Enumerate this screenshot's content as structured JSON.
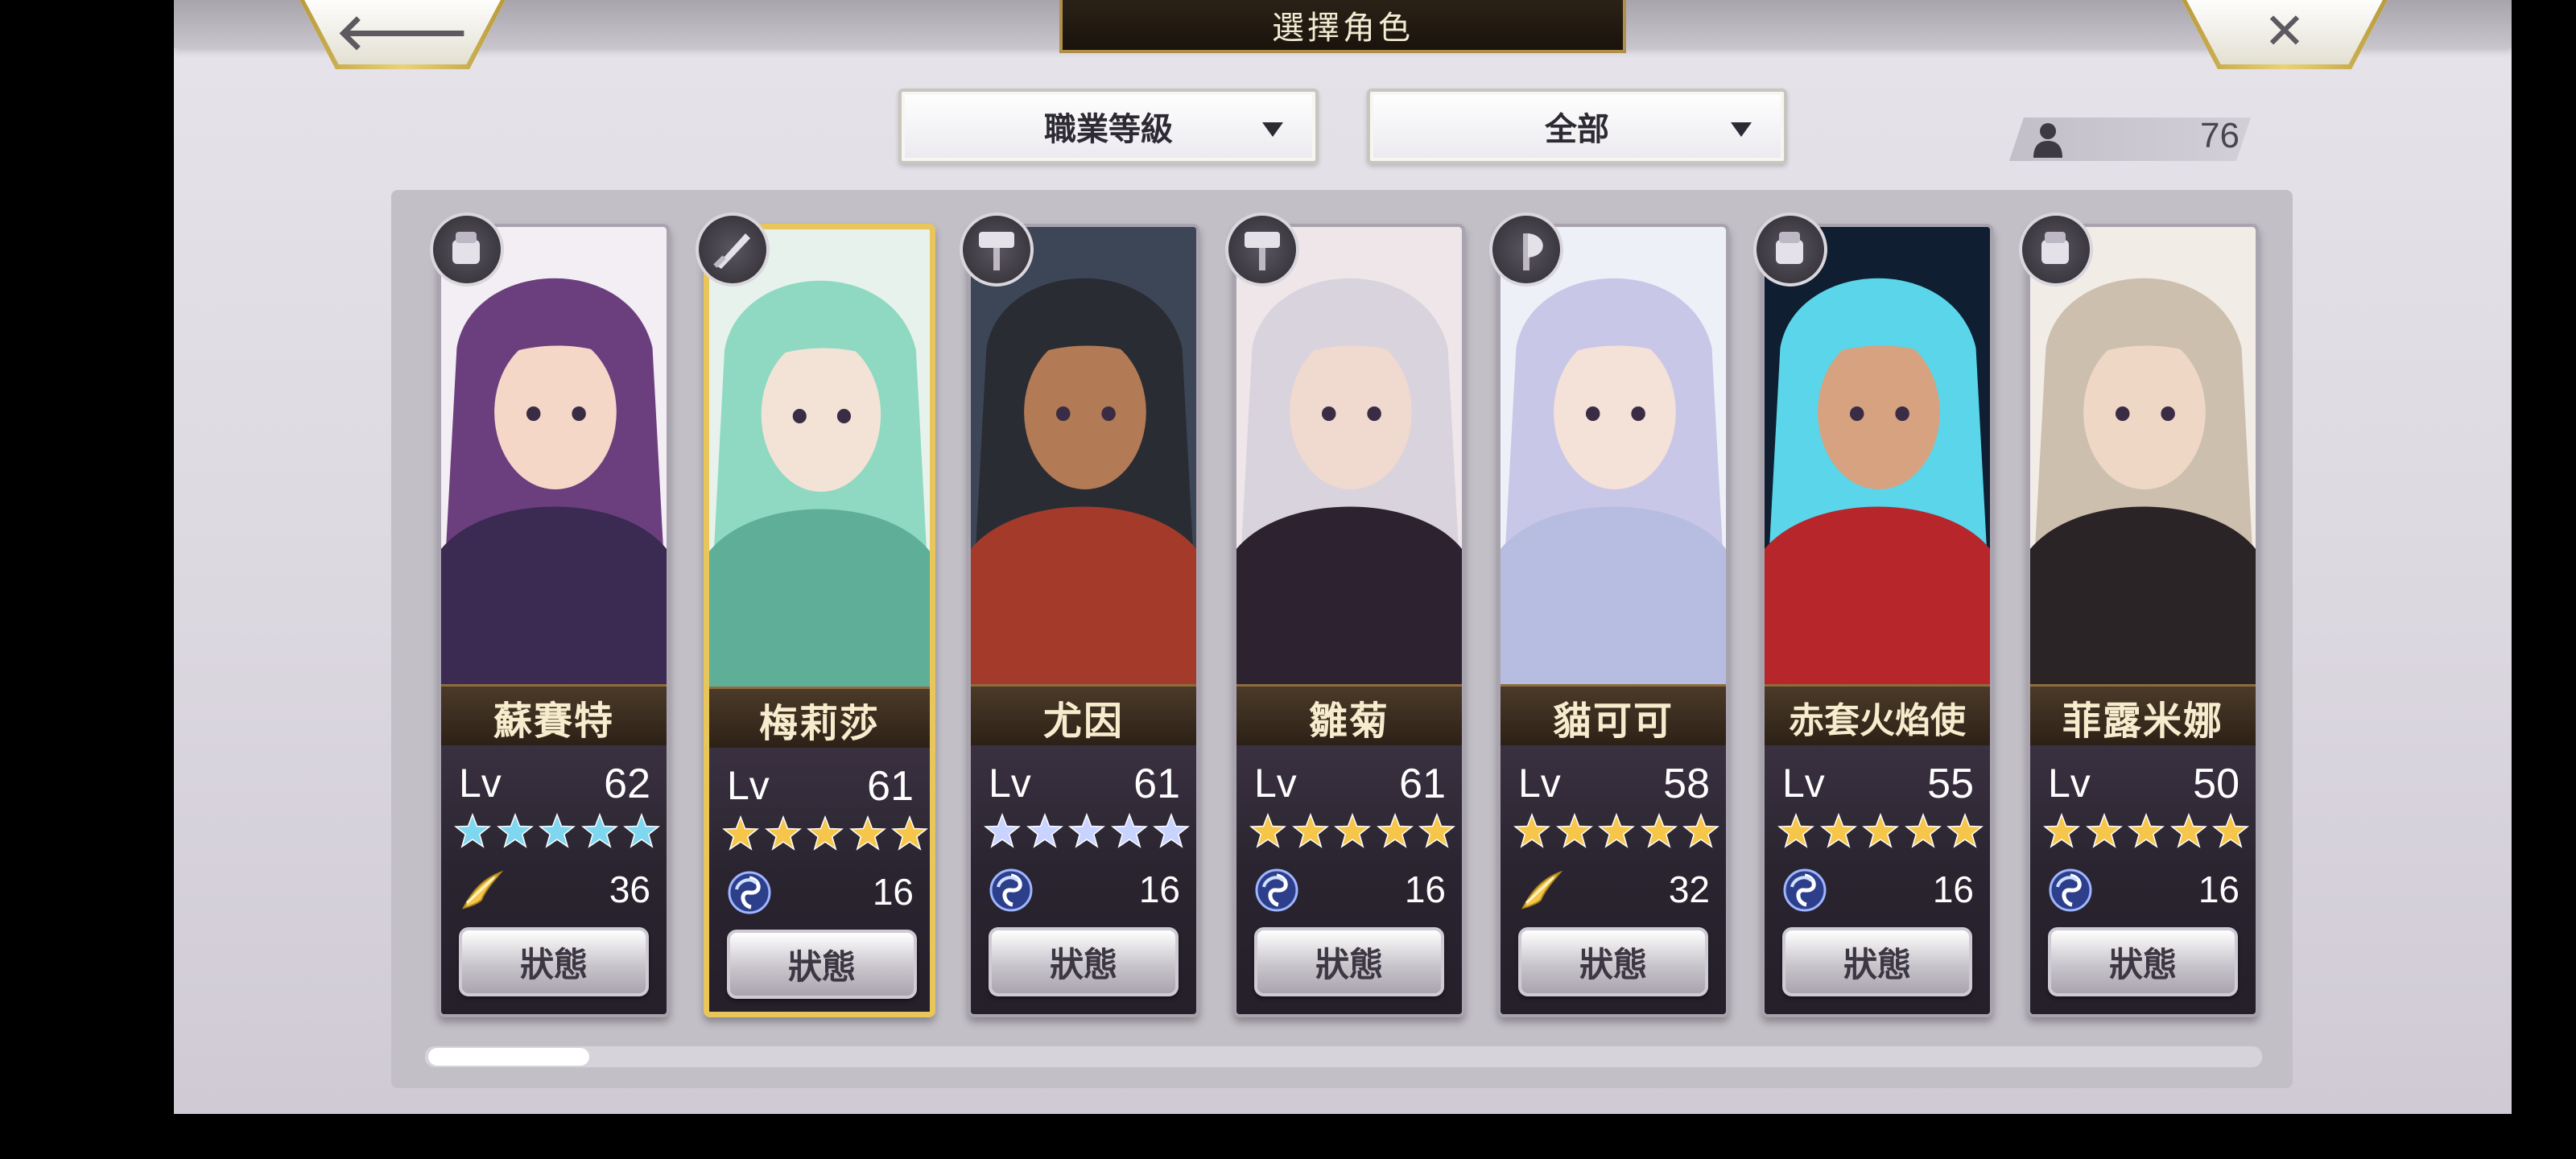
{
  "header": {
    "title": "選擇角色",
    "back_symbol": "🡐",
    "close_symbol": "✕"
  },
  "filters": {
    "class_level_label": "職業等級",
    "all_label": "全部"
  },
  "character_count": "76",
  "status_label": "狀態",
  "colors": {
    "gold_star": "#f6c64b",
    "blue_star": "#7fd6ef",
    "selected_border": "#e9c65a"
  },
  "characters": [
    {
      "name": "蘇賽特",
      "lv_label": "Lv",
      "level": "62",
      "stars": 5,
      "star_color": "blue",
      "element_icon": "wind-wing-icon",
      "sub_value": "36",
      "weapon": "gauntlet-icon",
      "selected": false
    },
    {
      "name": "梅莉莎",
      "lv_label": "Lv",
      "level": "61",
      "stars": 5,
      "star_color": "gold",
      "element_icon": "swirl-icon",
      "sub_value": "16",
      "weapon": "sword-icon",
      "selected": true
    },
    {
      "name": "尤因",
      "lv_label": "Lv",
      "level": "61",
      "stars": 5,
      "star_color": "silver-blue",
      "element_icon": "swirl-icon",
      "sub_value": "16",
      "weapon": "hammer-icon",
      "selected": false
    },
    {
      "name": "雛菊",
      "lv_label": "Lv",
      "level": "61",
      "stars": 5,
      "star_color": "gold",
      "element_icon": "swirl-icon",
      "sub_value": "16",
      "weapon": "hammer-icon",
      "selected": false
    },
    {
      "name": "貓可可",
      "lv_label": "Lv",
      "level": "58",
      "stars": 5,
      "star_color": "gold",
      "element_icon": "wind-wing-icon",
      "sub_value": "32",
      "weapon": "axe-icon",
      "selected": false
    },
    {
      "name": "赤套火焰使",
      "lv_label": "Lv",
      "level": "55",
      "stars": 5,
      "star_color": "gold",
      "element_icon": "swirl-icon",
      "sub_value": "16",
      "weapon": "gauntlet-icon",
      "selected": false
    },
    {
      "name": "菲露米娜",
      "lv_label": "Lv",
      "level": "50",
      "stars": 5,
      "star_color": "gold",
      "element_icon": "swirl-icon",
      "sub_value": "16",
      "weapon": "gauntlet-icon",
      "selected": false
    }
  ]
}
